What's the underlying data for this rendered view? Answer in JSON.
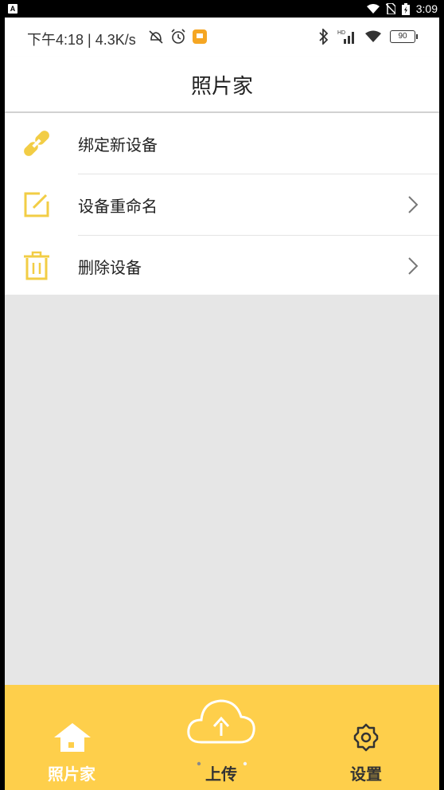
{
  "system_bar": {
    "time": "3:09"
  },
  "status_bar": {
    "time_text": "下午4:18 | 4.3K/s",
    "battery": "90"
  },
  "header": {
    "title": "照片家"
  },
  "menu": {
    "items": [
      {
        "label": "绑定新设备",
        "icon": "link-icon",
        "has_chevron": false
      },
      {
        "label": "设备重命名",
        "icon": "edit-icon",
        "has_chevron": true
      },
      {
        "label": "删除设备",
        "icon": "trash-icon",
        "has_chevron": true
      }
    ]
  },
  "tabbar": {
    "tabs": [
      {
        "label": "照片家",
        "icon": "home-icon"
      },
      {
        "label": "上传",
        "icon": "cloud-upload-icon"
      },
      {
        "label": "设置",
        "icon": "gear-icon"
      }
    ]
  },
  "colors": {
    "accent": "#fecf4b",
    "icon_yellow": "#f2cd45",
    "background": "#e6e6e6"
  }
}
